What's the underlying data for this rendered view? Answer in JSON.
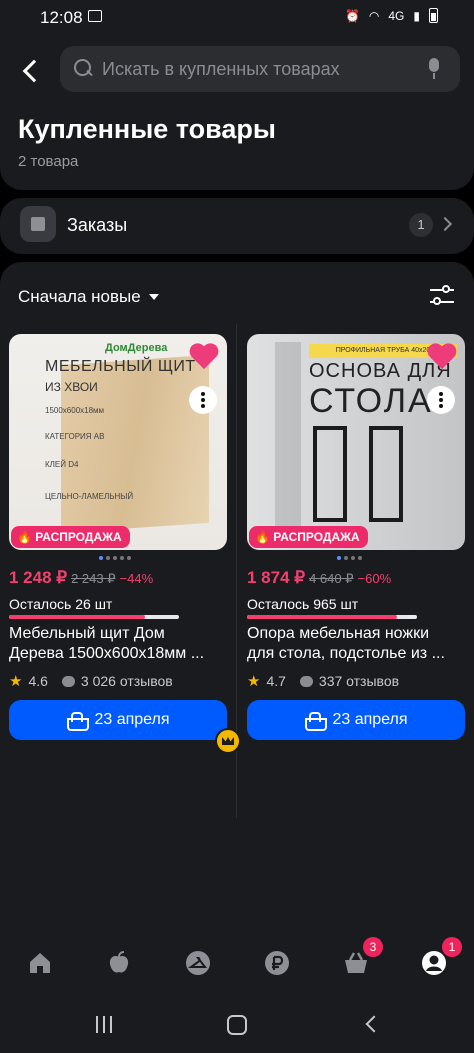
{
  "status_bar": {
    "time": "12:08",
    "network": "4G"
  },
  "search": {
    "placeholder": "Искать в купленных товарах"
  },
  "header": {
    "title": "Купленные товары",
    "subtitle": "2 товара"
  },
  "orders": {
    "label": "Заказы",
    "count": "1"
  },
  "sort": {
    "label": "Сначала новые"
  },
  "products": [
    {
      "photo_logo": "ДомДерева",
      "photo_title": "МЕБЕЛЬНЫЙ ЩИТ",
      "photo_subtitle": "ИЗ ХВОИ",
      "photo_specs": [
        "1500x600x18мм",
        "КАТЕГОРИЯ АВ",
        "КЛЕЙ D4",
        "ЦЕЛЬНО-ЛАМЕЛЬНЫЙ"
      ],
      "badge": "РАСПРОДАЖА",
      "price": "1 248 ₽",
      "old_price": "2 243 ₽",
      "discount": "−44%",
      "stock": "Осталось 26 шт",
      "stock_fraction": 0.8,
      "name_line1": "Мебельный щит Дом",
      "name_line2": "Дерева 1500x600x18мм ...",
      "rating": "4.6",
      "reviews": "3 026 отзывов",
      "delivery": "23 апреля",
      "favorite": true
    },
    {
      "photo_banner": "ПРОФИЛЬНАЯ ТРУБА 40x20",
      "photo_title": "ОСНОВА ДЛЯ",
      "photo_title2": "СТОЛА",
      "badge": "РАСПРОДАЖА",
      "price": "1 874 ₽",
      "old_price": "4 640 ₽",
      "discount": "−60%",
      "stock": "Осталось 965 шт",
      "stock_fraction": 0.88,
      "name_line1": "Опора мебельная ножки",
      "name_line2": "для стола, подстолье из ...",
      "rating": "4.7",
      "reviews": "337 отзывов",
      "delivery": "23 апреля",
      "favorite": true
    }
  ],
  "tabbar": {
    "items": [
      {
        "icon": "home-icon"
      },
      {
        "icon": "fresh-icon"
      },
      {
        "icon": "hanger-icon"
      },
      {
        "icon": "ruble-icon"
      },
      {
        "icon": "cart-icon",
        "badge": "3"
      },
      {
        "icon": "profile-icon",
        "badge": "1"
      }
    ]
  },
  "colors": {
    "accent": "#005bff",
    "sale": "#f43f6e",
    "badge": "#f0245d",
    "background": "#1a1b1f"
  }
}
